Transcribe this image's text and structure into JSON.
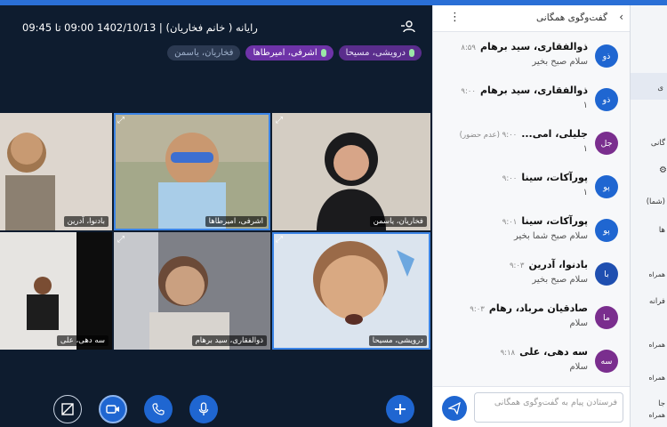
{
  "meeting": {
    "title": "رایانه ( خانم فخاریان) | 1402/10/13 09:00 تا 09:45",
    "speakers": [
      {
        "name": "فخاریان، یاسمن",
        "state": "muted"
      },
      {
        "name": "اشرفی، امیرطاها",
        "state": "active"
      },
      {
        "name": "درویشی، مسیحا",
        "state": "active"
      }
    ],
    "tiles": [
      {
        "label": "بادنوا، آدرین",
        "color": "#cfc3b5",
        "selected": false
      },
      {
        "label": "اشرفی، امیرطاها",
        "color": "#a8b6a8",
        "selected": true
      },
      {
        "label": "فخاریان، یاسمن",
        "color": "#c9c2b8",
        "selected": false
      },
      {
        "label": "سه دهی، علی",
        "color": "#5c5f64",
        "selected": false
      },
      {
        "label": "ذوالفقاری، سید برهام",
        "color": "#9a9da3",
        "selected": false
      },
      {
        "label": "درویشی، مسیحا",
        "color": "#cfd8e6",
        "selected": true
      }
    ]
  },
  "chat": {
    "title": "گفت‌وگوی همگانی",
    "placeholder": "فرستادن پیام به گفت‌وگوی همگانی",
    "messages": [
      {
        "initials": "ذو",
        "color": "#1f66d1",
        "name": "ذوالفقاری، سید برهام",
        "time": "۸:۵۹",
        "text": "سلام صبح بخیر"
      },
      {
        "initials": "ذو",
        "color": "#1f66d1",
        "name": "ذوالفقاری، سید برهام",
        "time": "۹:۰۰",
        "text": "۱"
      },
      {
        "initials": "جل",
        "color": "#7a2e8e",
        "name": "جلیلی، امی...",
        "time": "۹:۰۰ (عدم حضور)",
        "text": "۱"
      },
      {
        "initials": "پو",
        "color": "#1f66d1",
        "name": "پورآکات، سینا",
        "time": "۹:۰۰",
        "text": "۱"
      },
      {
        "initials": "پو",
        "color": "#1f66d1",
        "name": "پورآکات، سینا",
        "time": "۹:۰۱",
        "text": "سلام صبح شما بخیر"
      },
      {
        "initials": "با",
        "color": "#1f4fb0",
        "name": "بادنوا، آدرین",
        "time": "۹:۰۳",
        "text": "سلام صبح بخیر"
      },
      {
        "initials": "ما",
        "color": "#7a2e8e",
        "name": "صادقیان مرباد، رهام",
        "time": "۹:۰۳",
        "text": "سلام"
      },
      {
        "initials": "سه",
        "color": "#7a2e8e",
        "name": "سه دهی، علی",
        "time": "۹:۱۸",
        "text": "سلام"
      }
    ]
  },
  "side": {
    "rows": [
      "ی",
      "گانی",
      "(شما)",
      "ها",
      "همراه",
      "فرانه",
      "همراه",
      "همراه",
      "جا",
      "همراه"
    ]
  }
}
